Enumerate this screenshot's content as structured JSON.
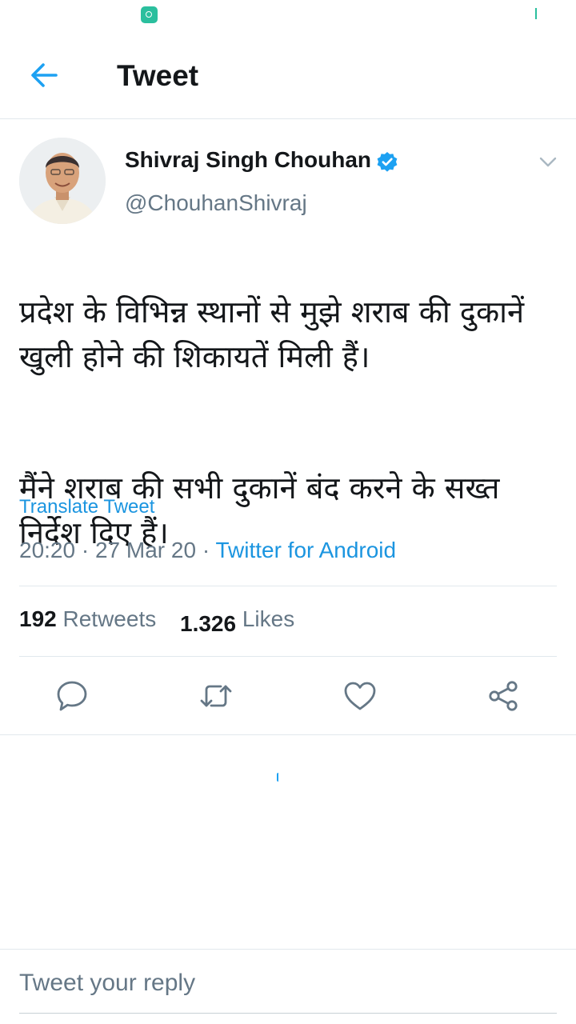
{
  "status_bar": {
    "app_icon": "chat-bubble-icon",
    "signal_icon": "signal-tick-icon"
  },
  "header": {
    "back_icon": "back-arrow-icon",
    "title": "Tweet"
  },
  "tweet": {
    "author": {
      "name": "Shivraj Singh Chouhan",
      "handle": "@ChouhanShivraj",
      "verified": true,
      "avatar": "avatar-photo"
    },
    "text": [
      "प्रदेश के विभिन्न स्थानों से मुझे शराब की दुकानें खुली होने की शिकायतें मिली हैं।",
      "मैंने शराब की सभी दुकानें बंद करने के सख्त निर्देश दिए हैं।"
    ],
    "translate_label": "Translate Tweet",
    "time": "20:20",
    "date": "27 Mar 20",
    "separator": "·",
    "source": "Twitter for Android",
    "stats": {
      "retweets_count": "192",
      "retweets_label": "Retweets",
      "likes_count": "1.326",
      "likes_label": "Likes"
    },
    "actions": [
      "reply-icon",
      "retweet-icon",
      "like-icon",
      "share-icon"
    ]
  },
  "reply": {
    "placeholder": "Tweet your reply"
  },
  "colors": {
    "accent": "#1da1f2",
    "link": "#1b95e0",
    "text_primary": "#14171a",
    "text_secondary": "#657786",
    "divider": "#e1e8ed",
    "status_icon": "#2bbf9e"
  }
}
